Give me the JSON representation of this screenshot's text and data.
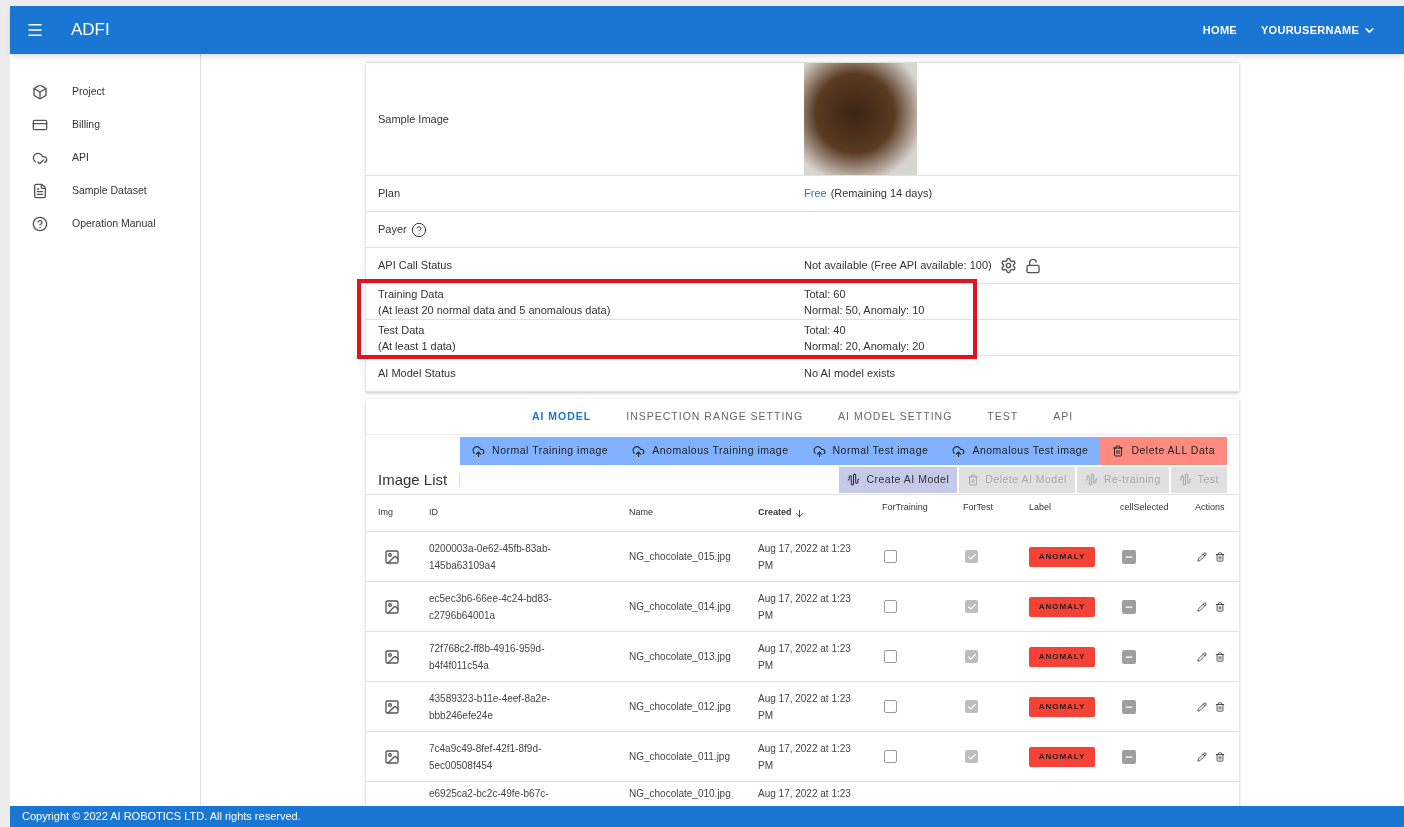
{
  "app_bar": {
    "title": "ADFI",
    "links": [
      {
        "label": "HOME",
        "kind": "link"
      },
      {
        "label": "YOURUSERNAME",
        "kind": "menu"
      }
    ]
  },
  "sidebar": {
    "items": [
      {
        "label": "Project"
      },
      {
        "label": "Billing"
      },
      {
        "label": "API"
      },
      {
        "label": "Sample Dataset"
      },
      {
        "label": "Operation Manual"
      }
    ]
  },
  "details": [
    {
      "kind": "image",
      "label": "Sample Image"
    },
    {
      "kind": "plan",
      "label": "Plan",
      "link": "Free",
      "value": "(Remaining 14 days)"
    },
    {
      "kind": "help",
      "label": "Payer"
    },
    {
      "kind": "api",
      "label": "API Call Status",
      "value": "Not available (Free API available: 100)"
    },
    {
      "kind": "two_line",
      "label": "Training Data",
      "sublabel": "(At least 20 normal data and 5 anomalous data)",
      "value": "Total: 60",
      "subvalue": "Normal: 50, Anomaly: 10"
    },
    {
      "kind": "two_line",
      "label": "Test Data",
      "sublabel": "(At least 1 data)",
      "value": "Total: 40",
      "subvalue": "Normal: 20, Anomaly: 20"
    },
    {
      "kind": "text",
      "label": "AI Model Status",
      "value": "No AI model exists"
    }
  ],
  "tabs": [
    {
      "label": "AI MODEL",
      "selected": true
    },
    {
      "label": "INSPECTION RANGE SETTING",
      "selected": false
    },
    {
      "label": "AI MODEL SETTING",
      "selected": false
    },
    {
      "label": "TEST",
      "selected": false
    },
    {
      "label": "API",
      "selected": false
    }
  ],
  "upload_buttons": [
    {
      "label": "Normal Training image",
      "kind": "upload"
    },
    {
      "label": "Anomalous Training image",
      "kind": "upload"
    },
    {
      "label": "Normal Test image",
      "kind": "upload"
    },
    {
      "label": "Anomalous Test image",
      "kind": "upload"
    },
    {
      "label": "Delete ALL Data",
      "kind": "delete"
    }
  ],
  "image_list": {
    "title": "Image List",
    "actions": [
      {
        "label": "Create AI Model",
        "kind": "model",
        "disabled": false
      },
      {
        "label": "Delete AI Model",
        "kind": "trash",
        "disabled": true
      },
      {
        "label": "Re-training",
        "kind": "model",
        "disabled": true
      },
      {
        "label": "Test",
        "kind": "model",
        "disabled": true
      }
    ],
    "columns": [
      {
        "label": "Img",
        "sorted": false
      },
      {
        "label": "ID",
        "sorted": false
      },
      {
        "label": "Name",
        "sorted": false
      },
      {
        "label": "Created",
        "sorted": true
      },
      {
        "label": "ForTraining",
        "sorted": false
      },
      {
        "label": "ForTest",
        "sorted": false
      },
      {
        "label": "Label",
        "sorted": false
      },
      {
        "label": "cellSelected",
        "sorted": false
      },
      {
        "label": "Actions",
        "sorted": false
      }
    ],
    "rows": [
      {
        "id": "0200003a-0e62-45fb-83ab-145ba63109a4",
        "name": "NG_chocolate_015.jpg",
        "created": "Aug 17, 2022 at 1:23 PM",
        "for_training": false,
        "for_test": true,
        "label": "ANOMALY",
        "cell_selected": true
      },
      {
        "id": "ec5ec3b6-66ee-4c24-bd83-c2796b64001a",
        "name": "NG_chocolate_014.jpg",
        "created": "Aug 17, 2022 at 1:23 PM",
        "for_training": false,
        "for_test": true,
        "label": "ANOMALY",
        "cell_selected": true
      },
      {
        "id": "72f768c2-ff8b-4916-959d-b4f4f011c54a",
        "name": "NG_chocolate_013.jpg",
        "created": "Aug 17, 2022 at 1:23 PM",
        "for_training": false,
        "for_test": true,
        "label": "ANOMALY",
        "cell_selected": true
      },
      {
        "id": "43589323-b11e-4eef-8a2e-bbb246efe24e",
        "name": "NG_chocolate_012.jpg",
        "created": "Aug 17, 2022 at 1:23 PM",
        "for_training": false,
        "for_test": true,
        "label": "ANOMALY",
        "cell_selected": true
      },
      {
        "id": "7c4a9c49-8fef-42f1-8f9d-5ec00508f454",
        "name": "NG_chocolate_011.jpg",
        "created": "Aug 17, 2022 at 1:23 PM",
        "for_training": false,
        "for_test": true,
        "label": "ANOMALY",
        "cell_selected": true
      }
    ],
    "partial_row": {
      "id": "e6925ca2-bc2c-49fe-b67c-",
      "name": "NG_chocolate_010.jpg",
      "created": "Aug 17, 2022 at 1:23"
    }
  },
  "footer": "Copyright © 2022 AI ROBOTICS LTD. All rights reserved."
}
